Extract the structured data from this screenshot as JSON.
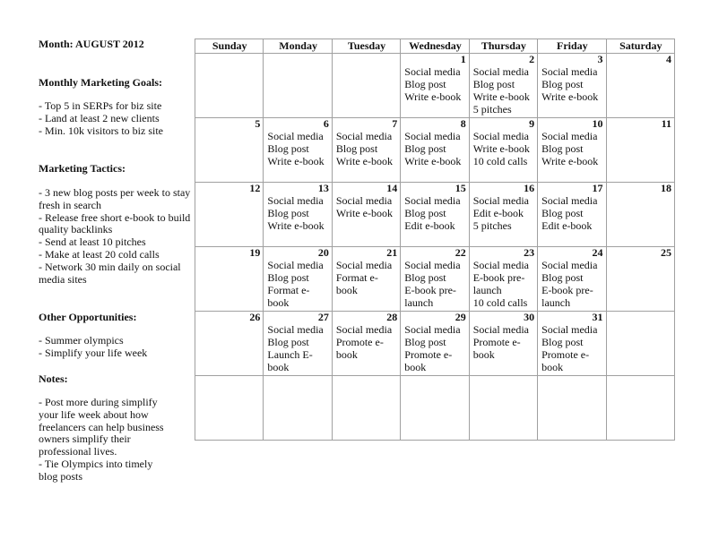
{
  "month_label": "Month:  AUGUST 2012",
  "sections": {
    "goals": {
      "title": "Monthly Marketing Goals:",
      "items": [
        "- Top 5 in SERPs for biz site",
        "- Land at least 2 new clients",
        "- Min. 10k visitors to biz site"
      ]
    },
    "tactics": {
      "title": "Marketing Tactics:",
      "items": [
        "- 3 new blog posts per week to stay fresh in search",
        "- Release free short e-book to build quality backlinks",
        "- Send at least 10 pitches",
        "- Make at least 20 cold calls",
        "- Network 30 min daily on social media sites"
      ]
    },
    "opportunities": {
      "title": "Other Opportunities:",
      "items": [
        "- Summer olympics",
        "- Simplify your life week"
      ]
    },
    "notes": {
      "title": "Notes:",
      "items": [
        "- Post more during simplify your life week about how freelancers can help business owners simplify their professional lives.",
        "- Tie Olympics into timely blog posts"
      ]
    }
  },
  "calendar": {
    "weekdays": [
      "Sunday",
      "Monday",
      "Tuesday",
      "Wednesday",
      "Thursday",
      "Friday",
      "Saturday"
    ],
    "weeks": [
      [
        {
          "day": "",
          "tasks": []
        },
        {
          "day": "",
          "tasks": []
        },
        {
          "day": "",
          "tasks": []
        },
        {
          "day": "1",
          "tasks": [
            "Social media",
            "Blog post",
            "Write e-book"
          ]
        },
        {
          "day": "2",
          "tasks": [
            "Social media",
            "Blog post",
            "Write e-book",
            "5 pitches"
          ]
        },
        {
          "day": "3",
          "tasks": [
            "Social media",
            "Blog post",
            "Write e-book"
          ]
        },
        {
          "day": "4",
          "tasks": []
        }
      ],
      [
        {
          "day": "5",
          "tasks": []
        },
        {
          "day": "6",
          "tasks": [
            "Social media",
            "Blog post",
            "Write e-book"
          ]
        },
        {
          "day": "7",
          "tasks": [
            "Social media",
            "Blog post",
            "Write e-book"
          ]
        },
        {
          "day": "8",
          "tasks": [
            "Social media",
            "Blog post",
            "Write e-book"
          ]
        },
        {
          "day": "9",
          "tasks": [
            "Social media",
            "Write e-book",
            "10 cold calls"
          ]
        },
        {
          "day": "10",
          "tasks": [
            "Social media",
            "Blog post",
            "Write e-book"
          ]
        },
        {
          "day": "11",
          "tasks": []
        }
      ],
      [
        {
          "day": "12",
          "tasks": []
        },
        {
          "day": "13",
          "tasks": [
            "Social media",
            "Blog post",
            "Write e-book"
          ]
        },
        {
          "day": "14",
          "tasks": [
            "Social media",
            "Write e-book"
          ]
        },
        {
          "day": "15",
          "tasks": [
            "Social media",
            "Blog post",
            "Edit e-book"
          ]
        },
        {
          "day": "16",
          "tasks": [
            "Social media",
            "Edit e-book",
            "5 pitches"
          ]
        },
        {
          "day": "17",
          "tasks": [
            "Social media",
            "Blog post",
            "Edit e-book"
          ]
        },
        {
          "day": "18",
          "tasks": []
        }
      ],
      [
        {
          "day": "19",
          "tasks": []
        },
        {
          "day": "20",
          "tasks": [
            "Social media",
            "Blog post",
            "Format e-book"
          ]
        },
        {
          "day": "21",
          "tasks": [
            "Social media",
            "Format e-book"
          ]
        },
        {
          "day": "22",
          "tasks": [
            "Social media",
            "Blog post",
            "E-book pre-launch"
          ]
        },
        {
          "day": "23",
          "tasks": [
            "Social media",
            "E-book pre-launch",
            "10 cold calls"
          ]
        },
        {
          "day": "24",
          "tasks": [
            "Social media",
            "Blog post",
            "E-book pre-launch"
          ]
        },
        {
          "day": "25",
          "tasks": []
        }
      ],
      [
        {
          "day": "26",
          "tasks": []
        },
        {
          "day": "27",
          "tasks": [
            "Social media",
            "Blog post",
            "Launch E-book"
          ]
        },
        {
          "day": "28",
          "tasks": [
            "Social media",
            "Promote e-book"
          ]
        },
        {
          "day": "29",
          "tasks": [
            "Social media",
            "Blog post",
            "Promote e-book"
          ]
        },
        {
          "day": "30",
          "tasks": [
            "Social media",
            "Promote e-book"
          ]
        },
        {
          "day": "31",
          "tasks": [
            "Social media",
            "Blog post",
            "Promote e-book"
          ]
        },
        {
          "day": "",
          "tasks": []
        }
      ],
      [
        {
          "day": "",
          "tasks": []
        },
        {
          "day": "",
          "tasks": []
        },
        {
          "day": "",
          "tasks": []
        },
        {
          "day": "",
          "tasks": []
        },
        {
          "day": "",
          "tasks": []
        },
        {
          "day": "",
          "tasks": []
        },
        {
          "day": "",
          "tasks": []
        }
      ]
    ]
  }
}
